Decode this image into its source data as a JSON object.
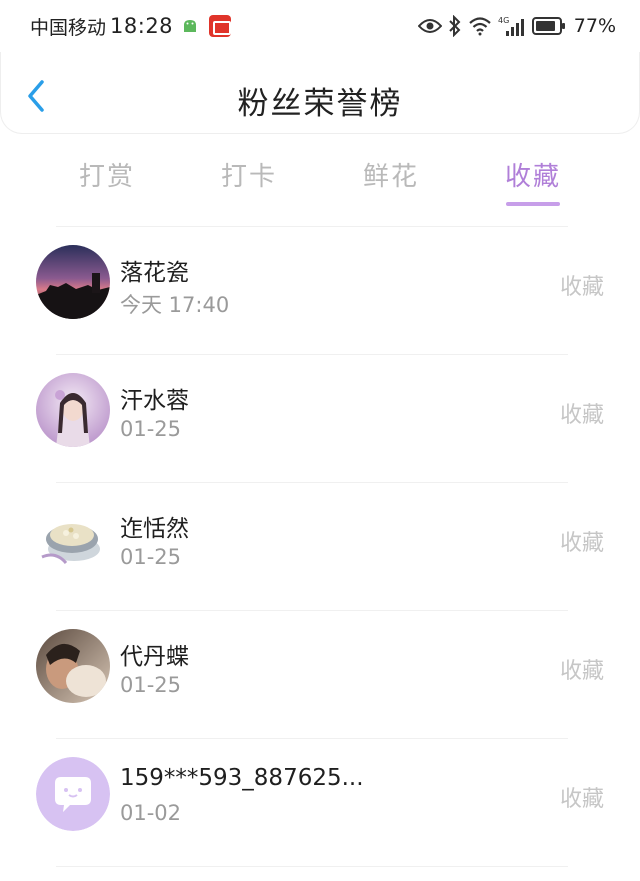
{
  "status_bar": {
    "carrier": "中国移动",
    "time": "18:28",
    "network": "4G",
    "battery": "77%",
    "icons": [
      "android-icon",
      "app-notification-icon",
      "eye-icon",
      "bluetooth-icon",
      "wifi-icon",
      "signal-icon",
      "battery-icon"
    ]
  },
  "header": {
    "title": "粉丝荣誉榜",
    "back_icon": "chevron-left-icon",
    "accent_color": "#2a9ee8"
  },
  "tabs": [
    {
      "label": "打赏",
      "active": false
    },
    {
      "label": "打卡",
      "active": false
    },
    {
      "label": "鲜花",
      "active": false
    },
    {
      "label": "收藏",
      "active": true
    }
  ],
  "active_color": "#b07fd8",
  "fans": [
    {
      "name": "落花瓷",
      "date": "今天 17:40",
      "action": "收藏",
      "avatar": "sunset-photo"
    },
    {
      "name": "汗水蓉",
      "date": "01-25",
      "action": "收藏",
      "avatar": "portrait-girl"
    },
    {
      "name": "迮恬然",
      "date": "01-25",
      "action": "收藏",
      "avatar": "bowl-of-food"
    },
    {
      "name": "代丹蝶",
      "date": "01-25",
      "action": "收藏",
      "avatar": "person-photo"
    },
    {
      "name": "159***593_887625...",
      "date": "01-02",
      "action": "收藏",
      "avatar": "default-chat-avatar"
    }
  ]
}
